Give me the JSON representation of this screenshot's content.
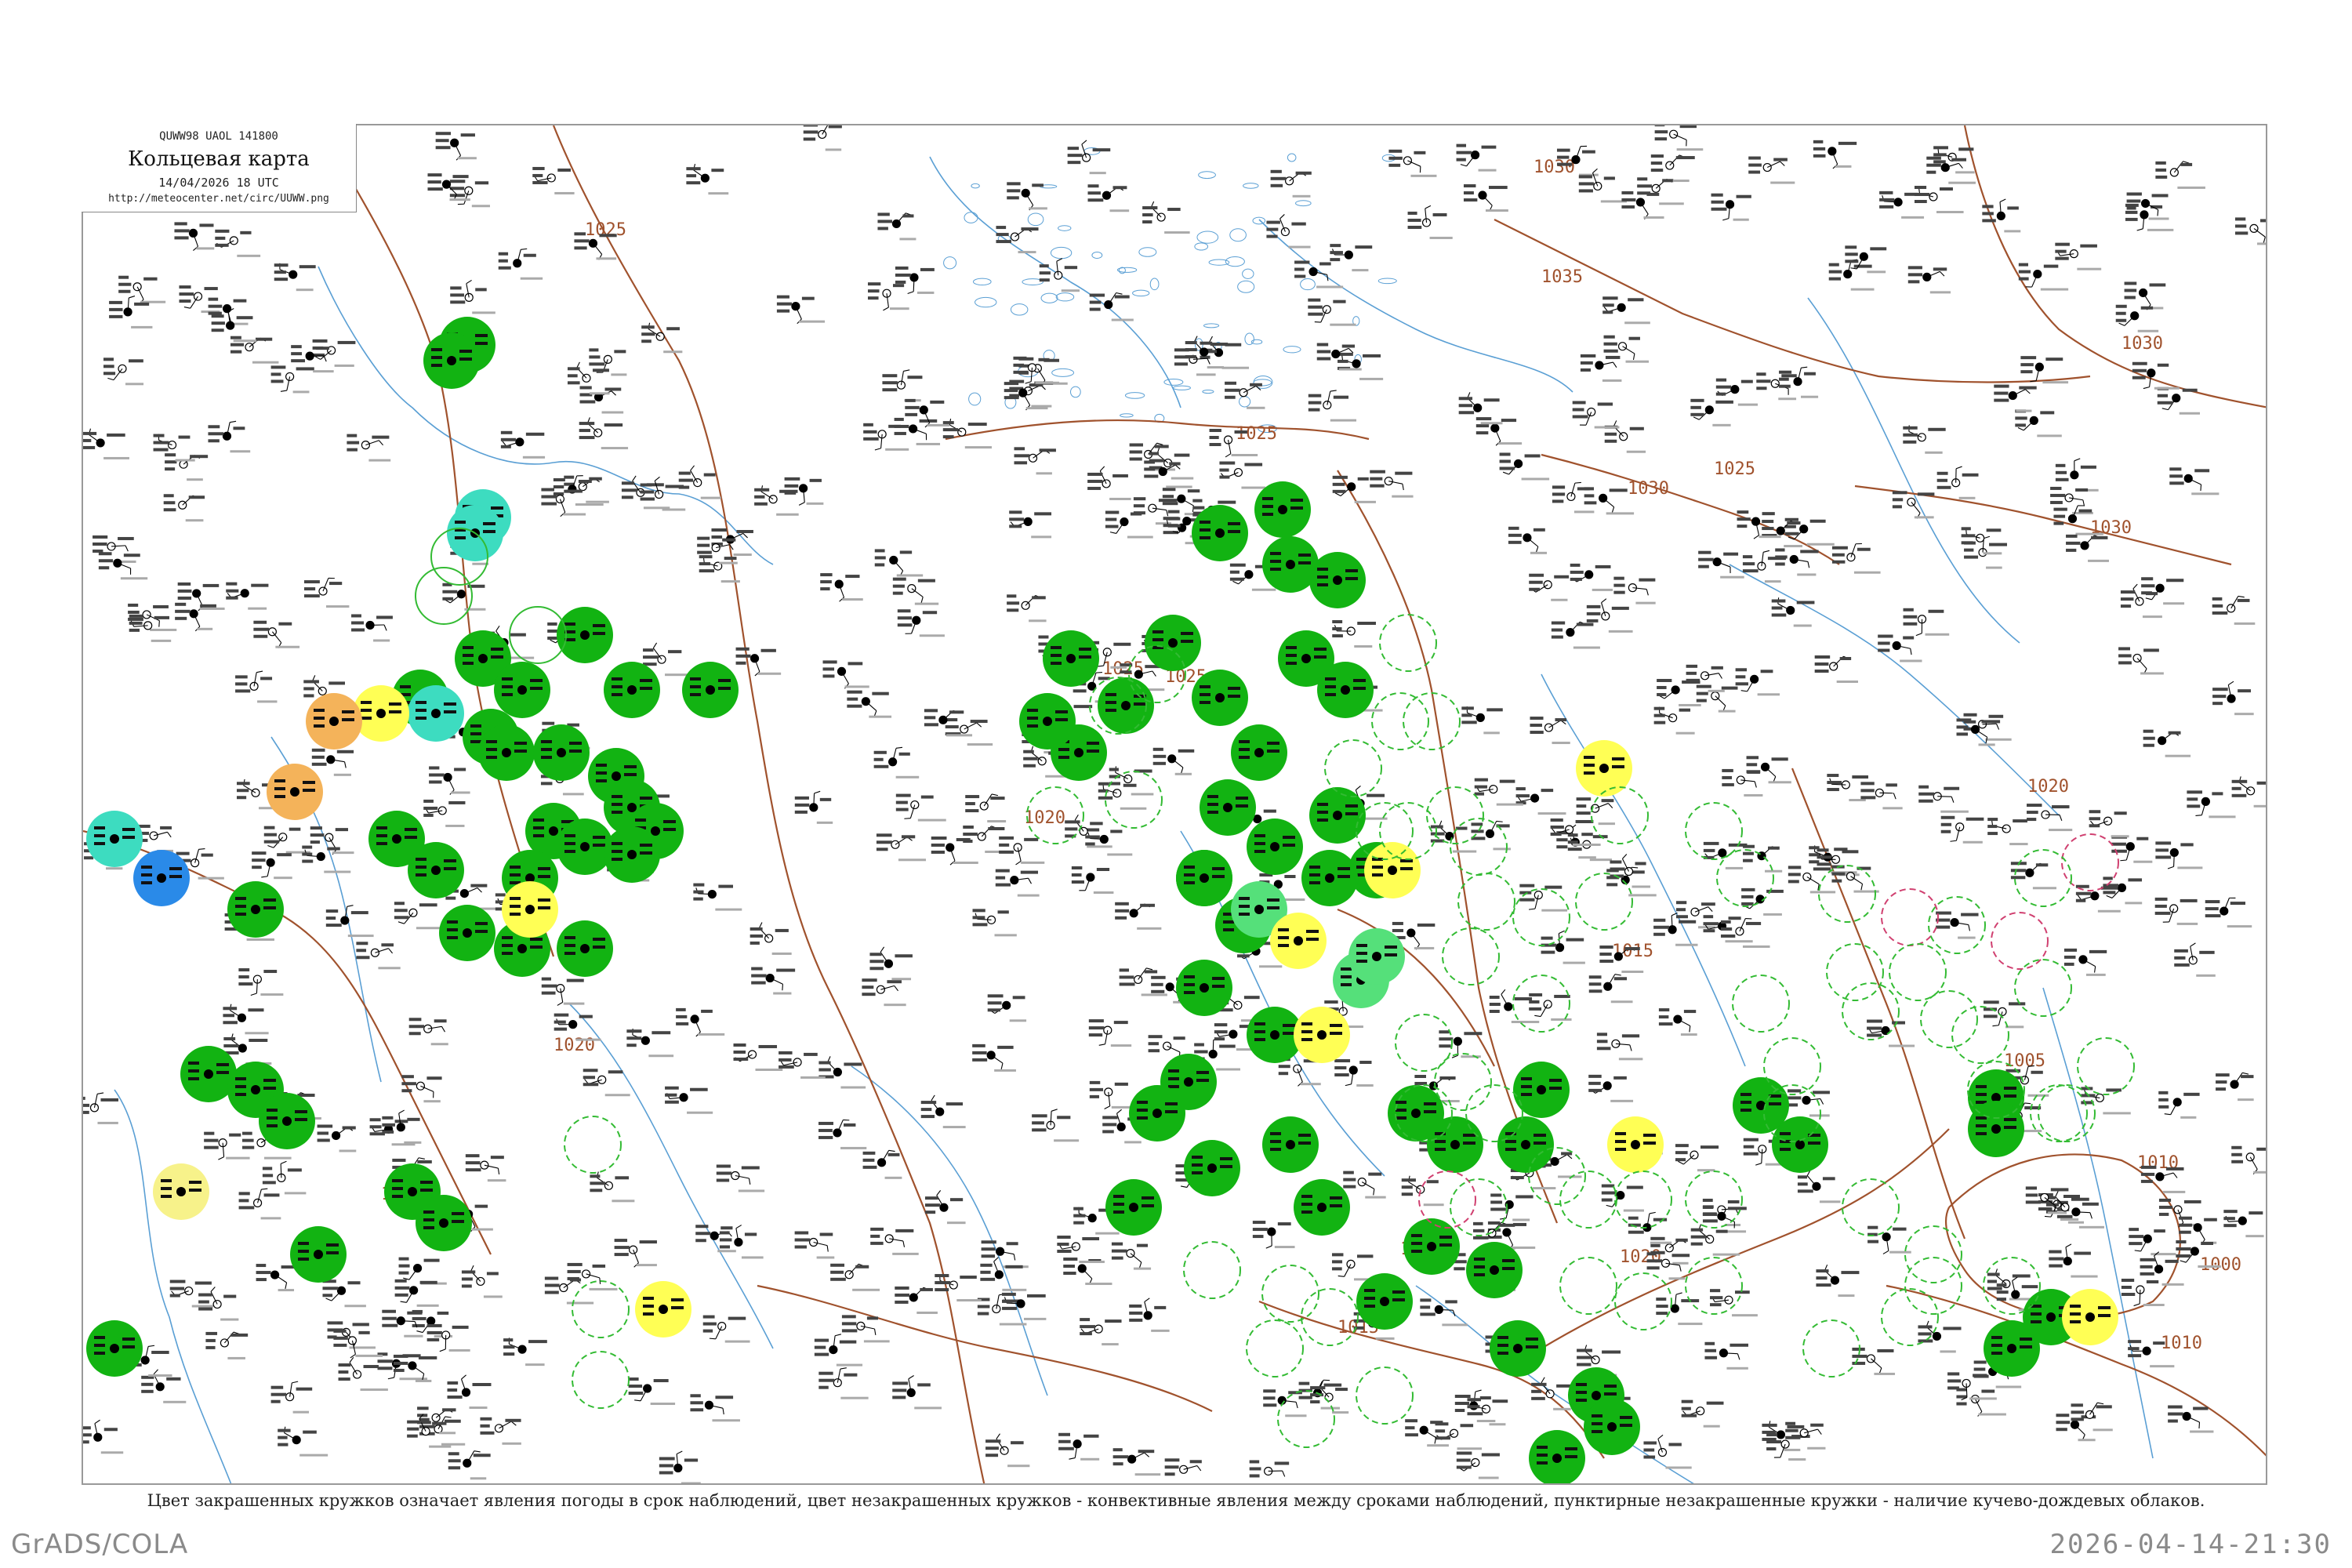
{
  "header": {
    "code": "QUWW98  UAOL  141800",
    "title": "Кольцевая карта",
    "date": "14/04/2026 18 UTC",
    "url": "http://meteocenter.net/circ/UUWW.png"
  },
  "isobars": {
    "color": "#a0522d",
    "labels": [
      "1025",
      "1035",
      "1030",
      "1030",
      "1030",
      "1030",
      "1025",
      "1025",
      "1025",
      "1020",
      "1020",
      "1020",
      "1020",
      "1015",
      "1015",
      "1010",
      "1010",
      "1005",
      "1000",
      "1020",
      "1025",
      "1020"
    ]
  },
  "legend_caption": "Цвет закрашенных кружков означает явления погоды в срок наблюдений, цвет незакрашенных кружков - конвективные явления между сроками наблюдений, пунктирные незакрашенные кружки - наличие кучево-дождевых облаков.",
  "footer": {
    "left": "GrADS/COLA",
    "right": "2026-04-14-21:30"
  },
  "colors": {
    "rain": "#12b312",
    "showers_light": "#55e07a",
    "teal": "#3ddcc0",
    "orange": "#f4b35a",
    "yellow": "#ffff55",
    "pale_yellow": "#f7f28a",
    "blue": "#2a8ae8",
    "river": "#5a9fd4",
    "station": "#000000",
    "isobar": "#a0522d",
    "frame": "#999999"
  }
}
